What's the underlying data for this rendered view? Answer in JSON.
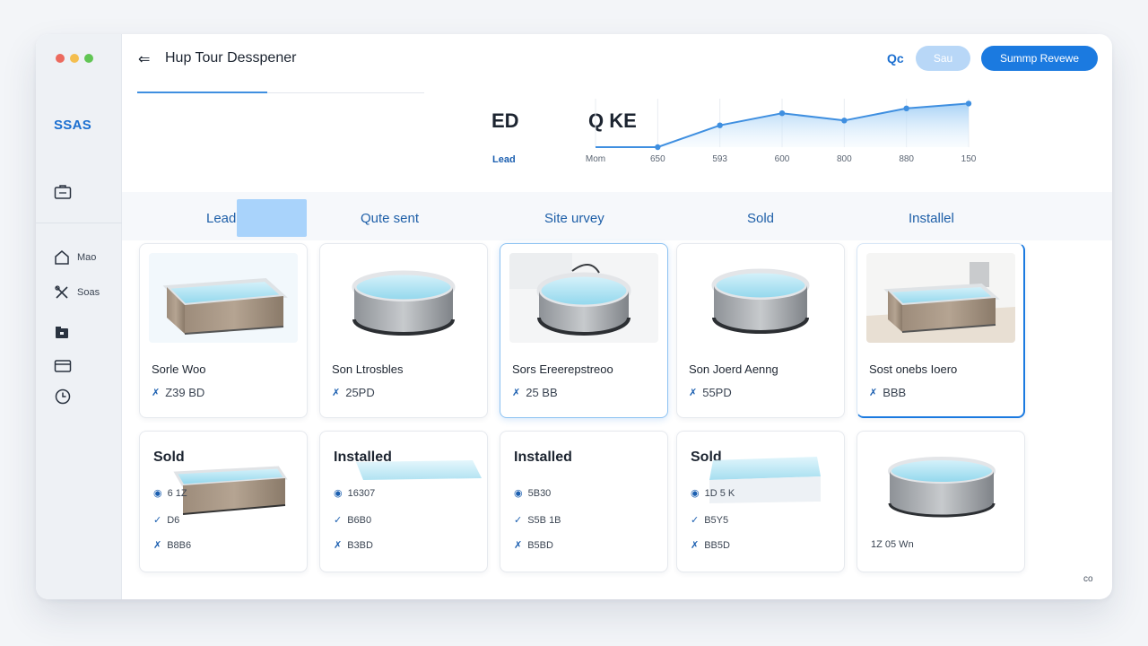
{
  "window": {
    "title": "Hup Tour Desspener"
  },
  "sidebar": {
    "brand": "SSAS",
    "items": [
      {
        "label": "Mao",
        "icon": "home-icon"
      },
      {
        "label": "Soas",
        "icon": "tools-icon"
      }
    ]
  },
  "header": {
    "link_label": "Qc",
    "ghost_button": "Sau",
    "primary_button": "Summp Revewe"
  },
  "stats": {
    "value_a": "ED",
    "label_a": "Lead",
    "value_b": "Q KE"
  },
  "chart_data": {
    "type": "area",
    "categories": [
      "Mom",
      "650",
      "593",
      "600",
      "800",
      "880",
      "150"
    ],
    "values": [
      0,
      0,
      9,
      14,
      11,
      16,
      18
    ],
    "title": "",
    "xlabel": "",
    "ylabel": "",
    "ylim": [
      0,
      20
    ],
    "color": "#3f8fe0"
  },
  "stages": [
    "Lead",
    "Qute sent",
    "Site urvey",
    "Sold",
    "Installel"
  ],
  "row1": [
    {
      "name": "Sorle Woo",
      "price": "Z39 BD",
      "tub": "rect-wood"
    },
    {
      "name": "Son Ltrosbles",
      "price": "25PD",
      "tub": "round-grey"
    },
    {
      "name": "Sors Ereerepstreoo",
      "price": "25 BB",
      "tub": "round-grey"
    },
    {
      "name": "Son Joerd Aenng",
      "price": "55PD",
      "tub": "round-grey"
    },
    {
      "name": "Sost onebs Ioero",
      "price": "BBB",
      "tub": "rect-wood"
    }
  ],
  "row2": [
    {
      "title": "Sold",
      "meta": [
        "6 1Z",
        "D6",
        "B8B6"
      ],
      "tub": "rect-wood"
    },
    {
      "title": "Installed",
      "meta": [
        "16307",
        "B6B0",
        "B3BD"
      ],
      "tub": "water-strip"
    },
    {
      "title": "Installed",
      "meta": [
        "5B30",
        "S5B 1B",
        "B5BD"
      ],
      "tub": "none"
    },
    {
      "title": "Sold",
      "meta": [
        "1D 5 K",
        "B5Y5",
        "BB5D"
      ],
      "tub": "water-strip"
    },
    {
      "title": "",
      "meta": [
        "1Z 05 Wn"
      ],
      "tub": "round-grey"
    }
  ],
  "footer": {
    "corner": "co"
  },
  "colors": {
    "accent": "#1b7ae0",
    "accent_light": "#a9d3fb",
    "sidebar_bg": "#eef1f5",
    "text": "#1c2430"
  }
}
